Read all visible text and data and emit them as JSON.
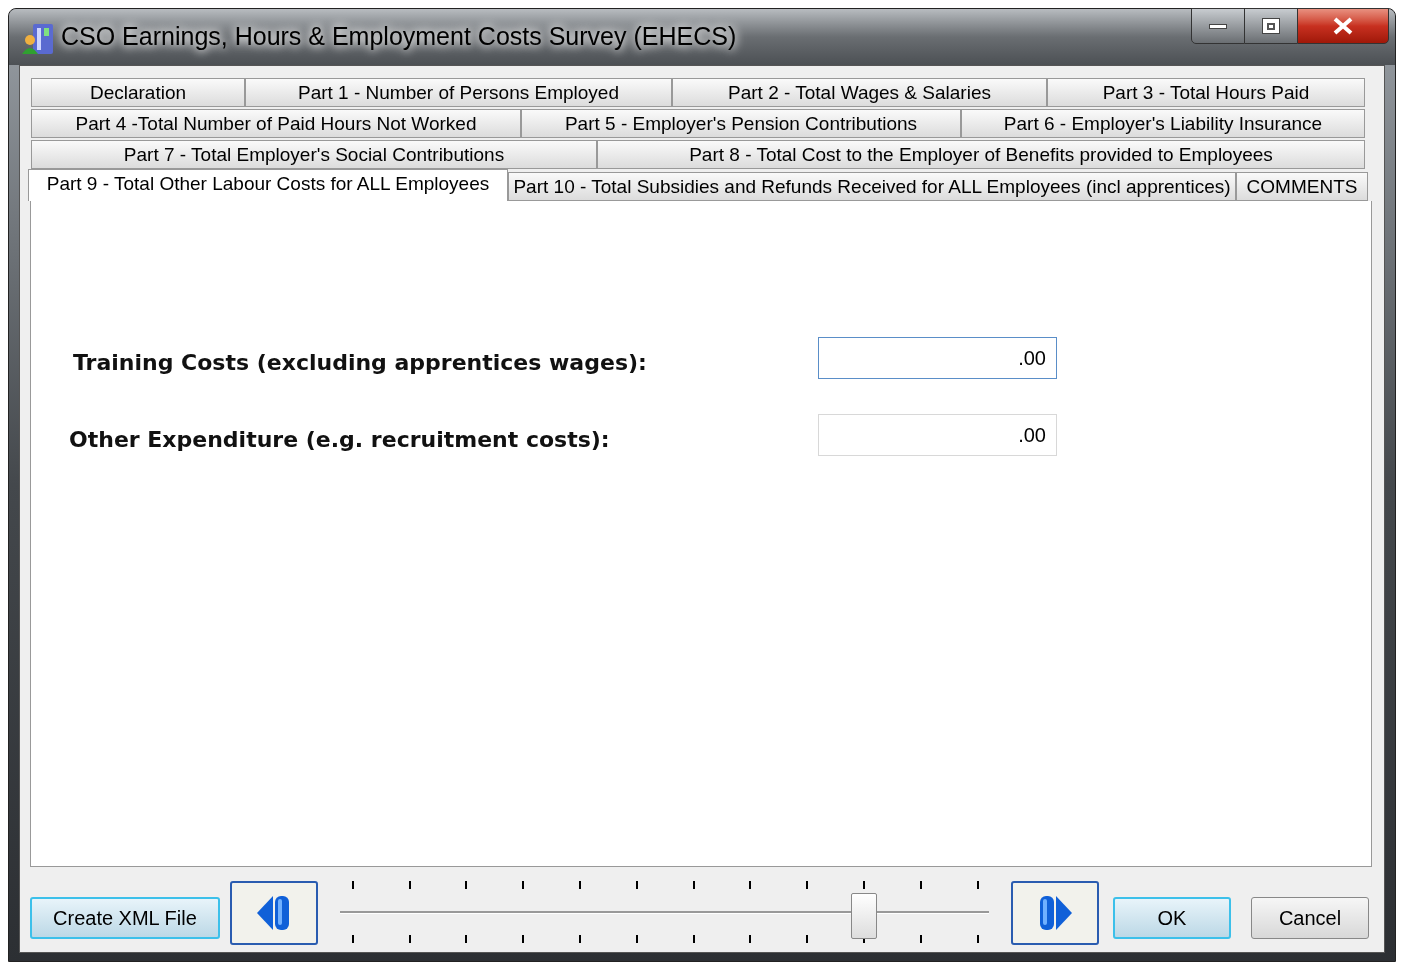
{
  "window": {
    "title": "CSO Earnings, Hours & Employment Costs Survey (EHECS)"
  },
  "tab_rows": [
    [
      {
        "label": "Declaration",
        "selected": false
      },
      {
        "label": "Part 1 - Number of Persons Employed",
        "selected": false
      },
      {
        "label": "Part 2 - Total Wages & Salaries",
        "selected": false
      },
      {
        "label": "Part 3 - Total Hours Paid",
        "selected": false
      }
    ],
    [
      {
        "label": "Part 4 -Total Number of Paid Hours Not Worked",
        "selected": false
      },
      {
        "label": "Part 5 - Employer's Pension Contributions",
        "selected": false
      },
      {
        "label": "Part 6 - Employer's Liability Insurance",
        "selected": false
      }
    ],
    [
      {
        "label": "Part 7 - Total Employer's Social Contributions",
        "selected": false
      },
      {
        "label": "Part 8 - Total Cost to the Employer of Benefits provided to Employees",
        "selected": false
      }
    ],
    [
      {
        "label": "Part 9 - Total Other Labour Costs for ALL Employees",
        "selected": true
      },
      {
        "label": "Part 10 - Total Subsidies and Refunds Received for ALL Employees (incl apprentices)",
        "selected": false
      },
      {
        "label": "COMMENTS",
        "selected": false
      }
    ]
  ],
  "fields": [
    {
      "label": "Training Costs (excluding apprentices wages):",
      "value": ".00",
      "focused": true
    },
    {
      "label": "Other Expenditure (e.g. recruitment costs):",
      "value": ".00",
      "focused": false
    }
  ],
  "create_button": "Create XML File",
  "slider": {
    "level": 0.818
  },
  "buttons": [
    {
      "label": "OK",
      "default": true
    },
    {
      "label": "Cancel",
      "default": false
    }
  ]
}
